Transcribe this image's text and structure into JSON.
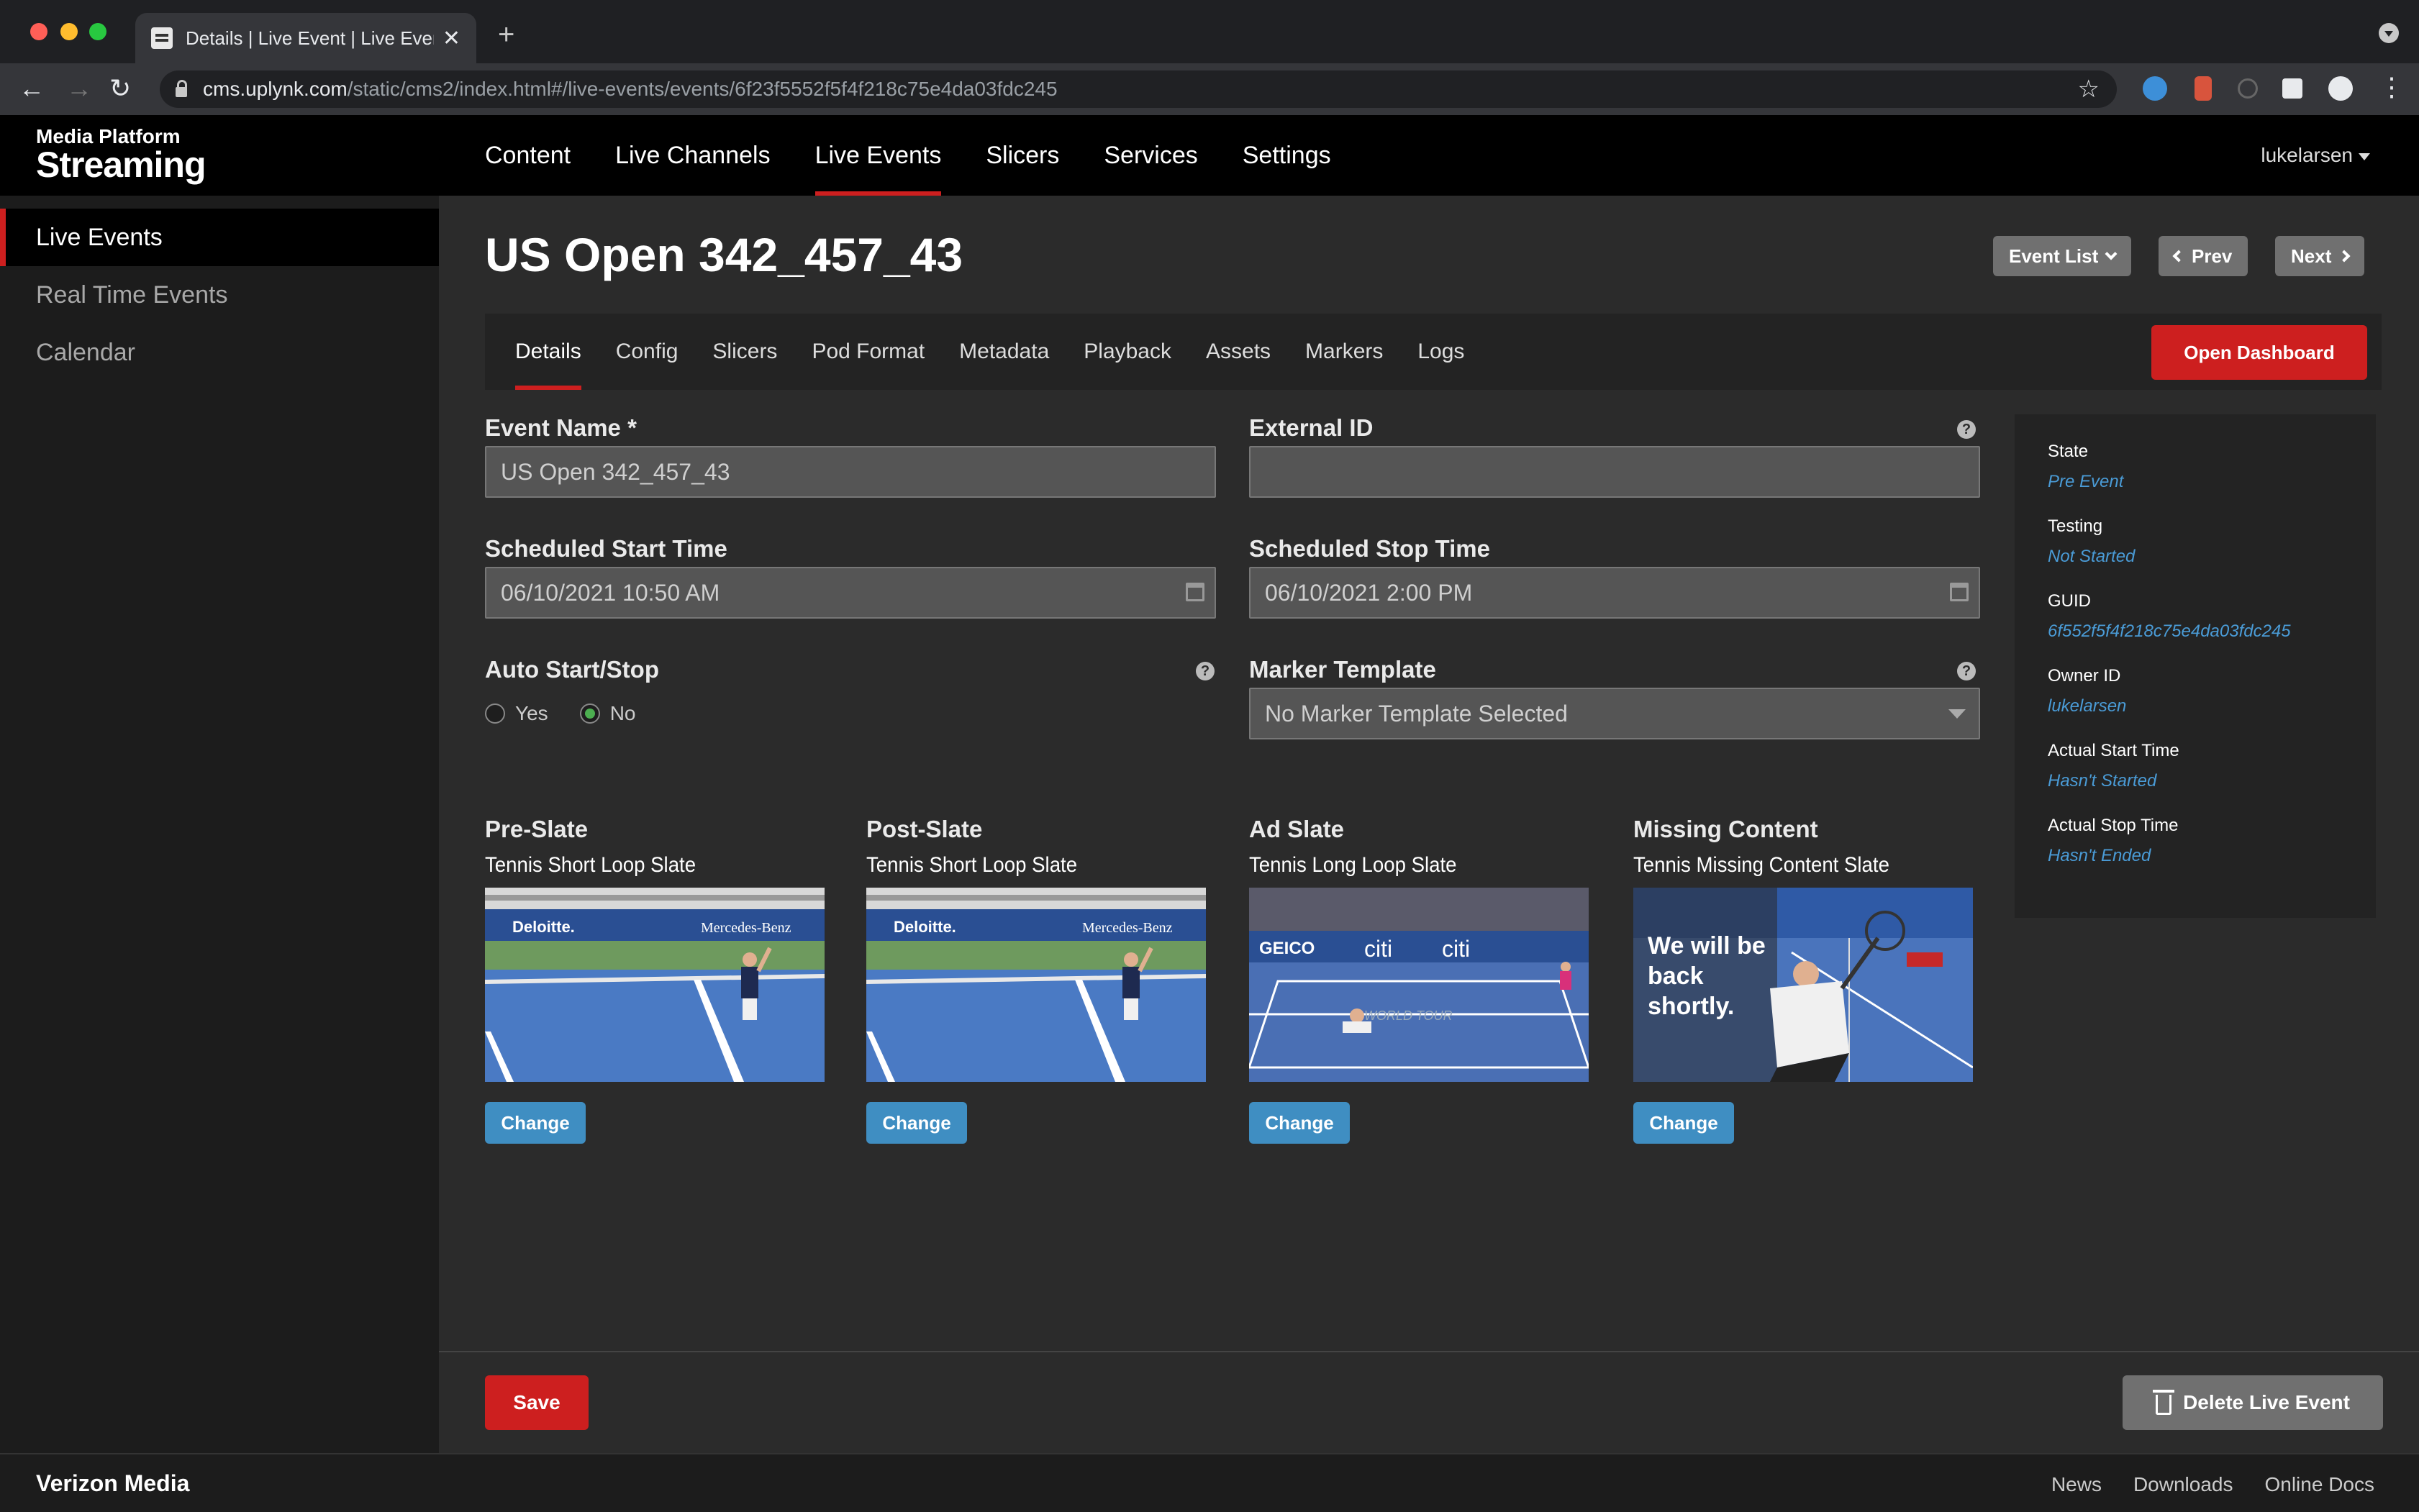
{
  "browser": {
    "tab_title": "Details | Live Event | Live Event",
    "url_host": "cms.uplynk.com",
    "url_path": "/static/cms2/index.html#/live-events/events/6f23f5552f5f4f218c75e4da03fdc245"
  },
  "header": {
    "logo_small": "Media Platform",
    "logo_big": "Streaming",
    "nav": [
      "Content",
      "Live Channels",
      "Live Events",
      "Slicers",
      "Services",
      "Settings"
    ],
    "user": "lukelarsen"
  },
  "sidebar": {
    "items": [
      {
        "label": "Live Events"
      },
      {
        "label": "Real Time Events"
      },
      {
        "label": "Calendar"
      }
    ]
  },
  "page": {
    "title": "US Open 342_457_43",
    "event_list_label": "Event List",
    "prev_label": "Prev",
    "next_label": "Next"
  },
  "tabs": [
    "Details",
    "Config",
    "Slicers",
    "Pod Format",
    "Metadata",
    "Playback",
    "Assets",
    "Markers",
    "Logs"
  ],
  "open_dashboard": "Open Dashboard",
  "form": {
    "event_name_label": "Event Name *",
    "event_name_value": "US Open 342_457_43",
    "external_id_label": "External ID",
    "external_id_value": "",
    "start_label": "Scheduled Start Time",
    "start_value": "06/10/2021 10:50 AM",
    "stop_label": "Scheduled Stop Time",
    "stop_value": "06/10/2021 2:00 PM",
    "auto_label": "Auto Start/Stop",
    "auto_yes": "Yes",
    "auto_no": "No",
    "marker_label": "Marker Template",
    "marker_value": "No Marker Template Selected"
  },
  "slates": [
    {
      "heading": "Pre-Slate",
      "name": "Tennis Short Loop Slate",
      "banner_left": "Deloitte.",
      "banner_right": "Mercedes-Benz"
    },
    {
      "heading": "Post-Slate",
      "name": "Tennis Short Loop Slate",
      "banner_left": "Deloitte.",
      "banner_right": "Mercedes-Benz"
    },
    {
      "heading": "Ad Slate",
      "name": "Tennis Long Loop Slate",
      "banner_left": "GEICO",
      "banner_right": "citi",
      "court_text": "WORLD TOUR"
    },
    {
      "heading": "Missing Content",
      "name": "Tennis Missing Content Slate",
      "overlay": "We will be back shortly."
    }
  ],
  "change_label": "Change",
  "info": [
    {
      "label": "State",
      "value": "Pre Event"
    },
    {
      "label": "Testing",
      "value": "Not Started"
    },
    {
      "label": "GUID",
      "value": "6f552f5f4f218c75e4da03fdc245"
    },
    {
      "label": "Owner ID",
      "value": "lukelarsen"
    },
    {
      "label": "Actual Start Time",
      "value": "Hasn't Started"
    },
    {
      "label": "Actual Stop Time",
      "value": "Hasn't Ended"
    }
  ],
  "actions": {
    "save": "Save",
    "delete": "Delete Live Event"
  },
  "footer": {
    "brand": "Verizon Media",
    "links": [
      "News",
      "Downloads",
      "Online Docs"
    ]
  },
  "colors": {
    "accent_red": "#cd1f1f",
    "link_blue": "#4a9bd6",
    "button_blue": "#3f8ec2"
  }
}
